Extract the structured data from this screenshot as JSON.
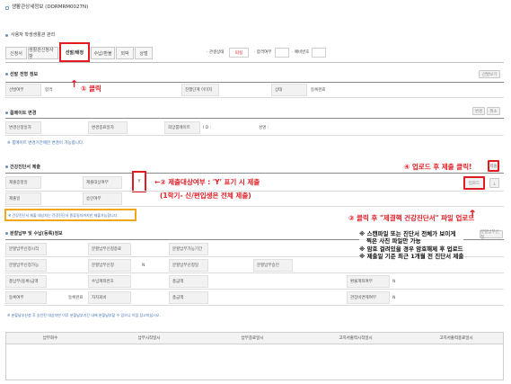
{
  "header": {
    "title": "생활관상세정보 (DORMRM0027N)"
  },
  "subheader": {
    "title": "사용자 학생생활관 관리"
  },
  "tabs": [
    {
      "label": "신청서"
    },
    {
      "label": "생활관신청사항"
    },
    {
      "label": "선발/배정"
    },
    {
      "label": "수납/환불"
    },
    {
      "label": "외박"
    },
    {
      "label": "상벌"
    }
  ],
  "filters": {
    "status_label": "· 관생상태",
    "status_value": "퇴실",
    "pass_label": "· 합격여부",
    "reserve_label": "· 예비번호"
  },
  "selection": {
    "title": "선발 전형 정보",
    "button": "선발보기",
    "label_result": "선발여부",
    "value_result": "합격",
    "label_progress": "진행단계 이미지",
    "label_state": "상태",
    "value_state": "등록완료"
  },
  "roommate": {
    "title": "룸메이트 변경",
    "button_change": "변경",
    "button_cancel": "취소",
    "label_room": "변경신청일자",
    "label_period": "변경종료일자",
    "label_mate": "희망룸메이트",
    "value_id": "I D :",
    "value_name": "성명 :",
    "note": "※ 룸메이트 변경기간에만 변경이 가능합니다."
  },
  "health": {
    "title": "건강진단서 제출",
    "button_submit": "제출",
    "button_upload": "업로드",
    "label_submit": "제출증정일",
    "label_target": "제출대상여부",
    "value_target": "Y",
    "label_date": "제출일",
    "label_approve": "승인여부",
    "note": "※ 건강진단서 제출 대상자는 건강진단서 종류일자까지만 제출가능합니다."
  },
  "payment": {
    "title": "분할납부 및 수납(등록)정보",
    "button": "분할납부신청",
    "rows": [
      [
        "분할납부신청시작",
        "분할납부신청종료",
        "",
        "분할납부가능기간"
      ],
      [
        "분할납부신청가능",
        "분할납부신청",
        "N",
        "분할납부신청일",
        "분할납부승인",
        ""
      ],
      [
        "총납부(등록)금액",
        "수납계좌번호",
        "",
        "총금액",
        "",
        "환불계좌여부",
        "N"
      ],
      [
        "등록여부",
        "등록완료",
        "자치회비",
        "",
        "총금액",
        "",
        "관장비면제여부",
        "N"
      ]
    ],
    "note": "※ 분할납부신청 후 승인된 대상자만 이후 분할납부기간 내에 분할납부할 수 있으니 이점 참고하십시오."
  },
  "table": {
    "headers": [
      "납부회수",
      "납부시작일시",
      "납부종료일시",
      "고지서출력시작일시",
      "고지서출력종료일시"
    ]
  },
  "annotations": {
    "a1": "① 클릭",
    "a2_line1": "←② 제출대상여부 : 'Y' 표기 시 제출",
    "a2_line2": "(1학기- 신/편입생은 전체 제출)",
    "a3": "③ 클릭 후 \"제결핵 건강진단서\" 파일 업로드",
    "a4": "④ 업로드 후 제출 클릭!",
    "note_lines": [
      "※ 스캔파일 또는 진단서 전체가 보이게",
      "찍은 사진 파일만 가능",
      "※ 암호 걸려있을 경우 암호해제 후 업로드",
      "※ 제출일 기준 최근 1개월 전 진단서 제출"
    ]
  },
  "colors": {
    "highlight_red": "#e21b23",
    "highlight_yellow": "#f0a818",
    "note_blue": "#3f6fb5"
  }
}
